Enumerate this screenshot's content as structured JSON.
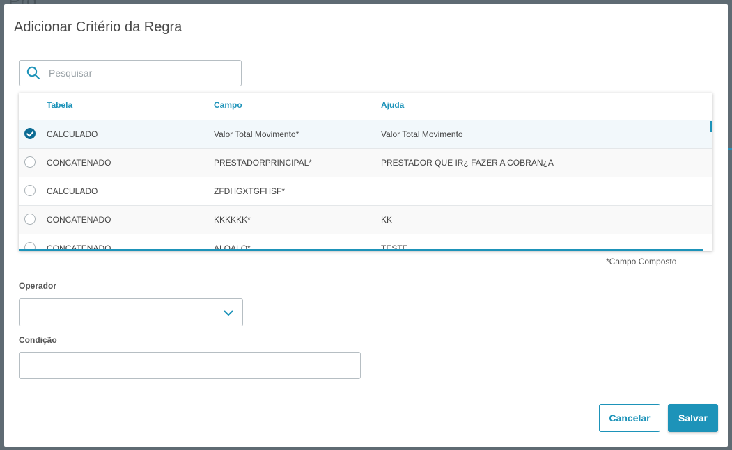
{
  "modal": {
    "title": "Adicionar Critério da Regra"
  },
  "search": {
    "placeholder": "Pesquisar",
    "value": ""
  },
  "grid": {
    "columns": [
      "Tabela",
      "Campo",
      "Ajuda"
    ],
    "rows": [
      {
        "tabela": "CALCULADO",
        "campo": "Valor Total Movimento*",
        "ajuda": "Valor Total Movimento",
        "selected": true
      },
      {
        "tabela": "CONCATENADO",
        "campo": "PRESTADORPRINCIPAL*",
        "ajuda": "PRESTADOR QUE IR¿ FAZER A COBRAN¿A",
        "selected": false
      },
      {
        "tabela": "CALCULADO",
        "campo": "ZFDHGXTGFHSF*",
        "ajuda": "",
        "selected": false
      },
      {
        "tabela": "CONCATENADO",
        "campo": "KKKKKK*",
        "ajuda": "KK",
        "selected": false
      },
      {
        "tabela": "CONCATENADO",
        "campo": "ALOALO*",
        "ajuda": "TESTE",
        "selected": false
      }
    ],
    "footnote": "*Campo Composto"
  },
  "form": {
    "operador_label": "Operador",
    "operador_value": "",
    "condicao_label": "Condição",
    "condicao_value": ""
  },
  "buttons": {
    "cancel": "Cancelar",
    "save": "Salvar"
  },
  "colors": {
    "accent": "#1d93b9",
    "selected_radio": "#0c6c94"
  },
  "icons": [
    "search-icon",
    "chevron-down-icon",
    "check-icon"
  ]
}
